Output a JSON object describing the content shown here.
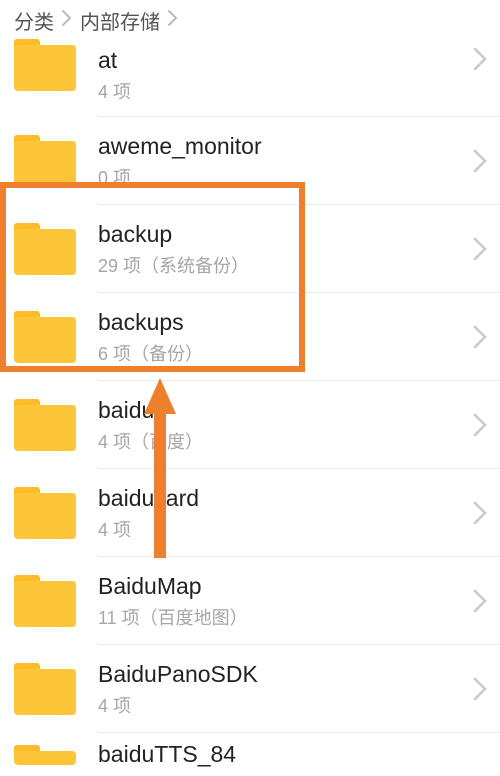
{
  "breadcrumb": {
    "crumb1": "分类",
    "crumb2": "内部存储"
  },
  "folders": [
    {
      "name": "at",
      "sub": "4 项"
    },
    {
      "name": "aweme_monitor",
      "sub": "0 项"
    },
    {
      "name": "backup",
      "sub": "29 项（系统备份）"
    },
    {
      "name": "backups",
      "sub": "6 项（备份）"
    },
    {
      "name": "baidu",
      "sub": "4 项（百度）"
    },
    {
      "name": "baiducard",
      "sub": "4 项"
    },
    {
      "name": "BaiduMap",
      "sub": "11 项（百度地图）"
    },
    {
      "name": "BaiduPanoSDK",
      "sub": "4 项"
    },
    {
      "name": "baiduTTS_84",
      "sub": ""
    }
  ],
  "annotations": {
    "highlight_color": "#ee7f2d",
    "arrow_color": "#ee7f2d"
  }
}
